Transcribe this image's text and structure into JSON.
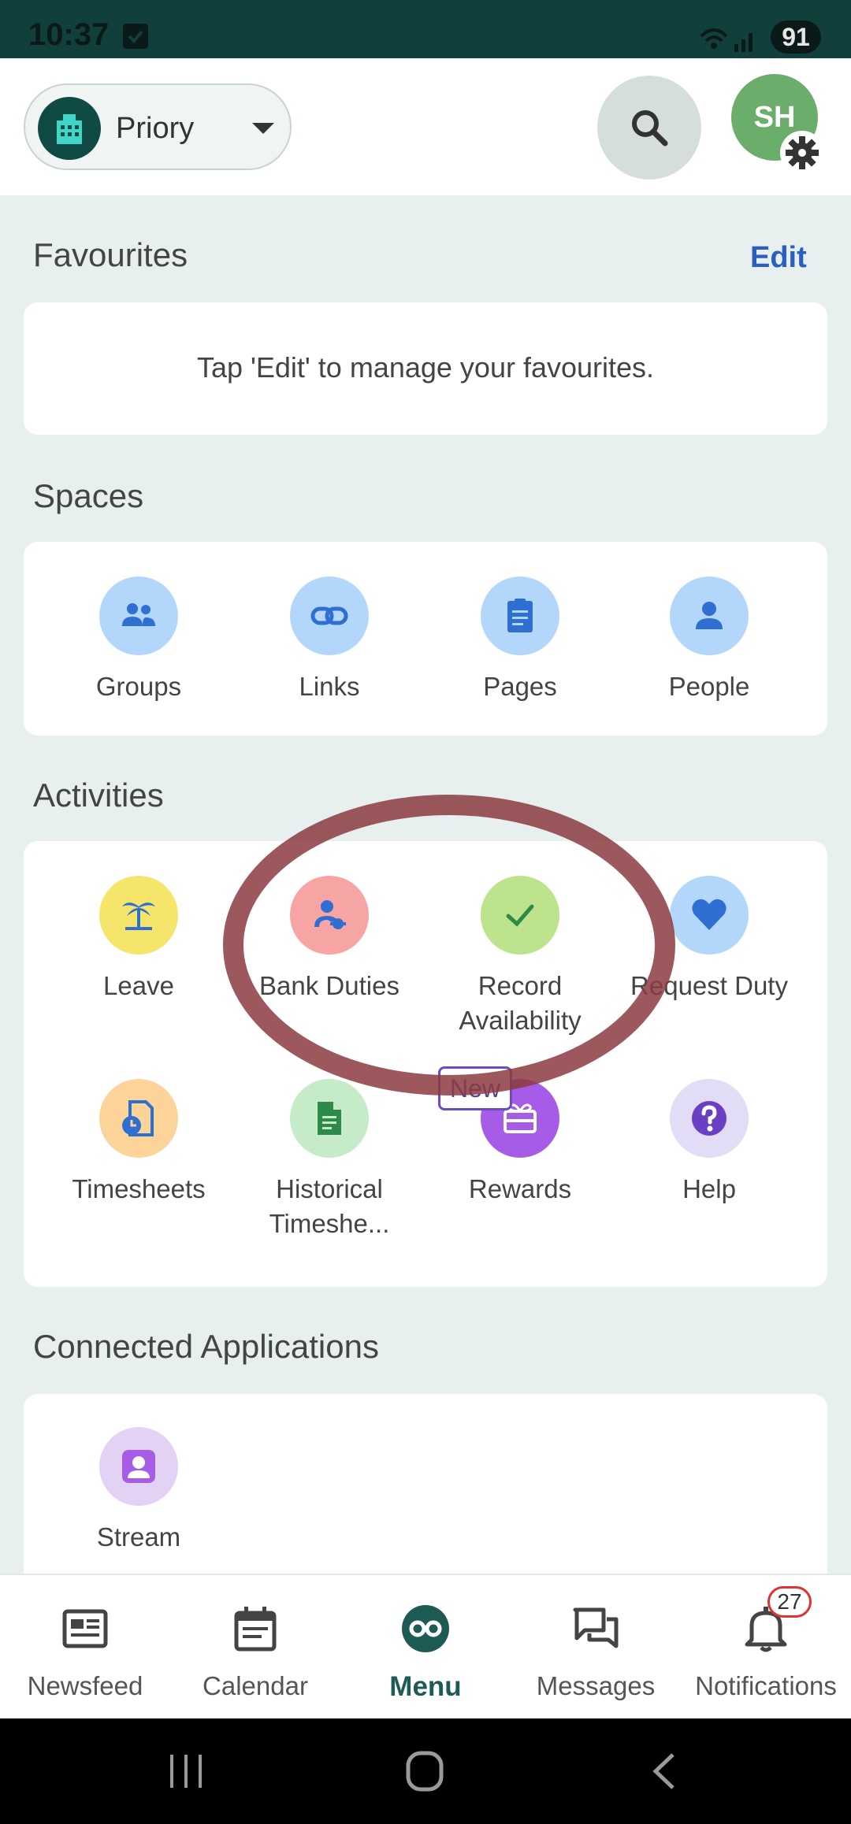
{
  "status_bar": {
    "time": "10:37",
    "battery": "91"
  },
  "header": {
    "org_name": "Priory",
    "avatar_initials": "SH"
  },
  "favourites": {
    "title": "Favourites",
    "edit_label": "Edit",
    "empty_message": "Tap 'Edit' to manage your favourites."
  },
  "spaces": {
    "title": "Spaces",
    "items": [
      {
        "label": "Groups",
        "icon": "groups-icon"
      },
      {
        "label": "Links",
        "icon": "link-icon"
      },
      {
        "label": "Pages",
        "icon": "pages-icon"
      },
      {
        "label": "People",
        "icon": "person-icon"
      }
    ]
  },
  "activities": {
    "title": "Activities",
    "items": [
      {
        "label": "Leave",
        "icon": "palm-tree-icon"
      },
      {
        "label": "Bank Duties",
        "icon": "bank-duties-icon"
      },
      {
        "label": "Record Availability",
        "icon": "check-icon"
      },
      {
        "label": "Request Duty",
        "icon": "heart-icon"
      },
      {
        "label": "Timesheets",
        "icon": "timesheet-icon"
      },
      {
        "label": "Historical Timeshe...",
        "icon": "document-icon"
      },
      {
        "label": "Rewards",
        "icon": "gift-icon",
        "badge": "New"
      },
      {
        "label": "Help",
        "icon": "help-icon"
      }
    ]
  },
  "connected_apps": {
    "title": "Connected Applications",
    "items": [
      {
        "label": "Stream",
        "icon": "stream-icon"
      }
    ]
  },
  "bottom_nav": {
    "items": [
      {
        "label": "Newsfeed",
        "icon": "newsfeed-icon"
      },
      {
        "label": "Calendar",
        "icon": "calendar-icon"
      },
      {
        "label": "Menu",
        "icon": "menu-icon",
        "active": true
      },
      {
        "label": "Messages",
        "icon": "messages-icon"
      },
      {
        "label": "Notifications",
        "icon": "bell-icon",
        "badge": "27"
      }
    ]
  },
  "colors": {
    "primary": "#11403c",
    "accent": "#2a5fbf",
    "annotation": "#8b3b3f"
  }
}
